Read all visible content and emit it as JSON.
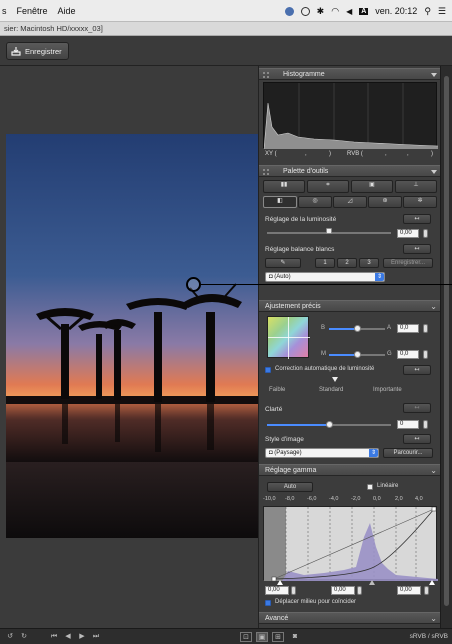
{
  "menubar": {
    "items": [
      "s",
      "Fenêtre",
      "Aide"
    ],
    "clock": "ven. 20:12",
    "flag": "A"
  },
  "window": {
    "title": "sier: Macintosh HD/xxxxx_03]"
  },
  "toolbar": {
    "save_label": "Enregistrer"
  },
  "histogram": {
    "title": "Histogramme",
    "xy_label": "XY (",
    "xy_sep1": ",",
    "xy_close": ")",
    "rvb_label": "RVB (",
    "rvb_sep": ",",
    "rvb_close": ")"
  },
  "tools": {
    "title": "Palette d'outils",
    "brightness_label": "Réglage de la luminosité",
    "brightness_value": "0,00",
    "wb_label": "Réglage balance blancs",
    "wb_btn1": "1",
    "wb_btn2": "2",
    "wb_btn3": "3",
    "wb_register": "Enregistrer...",
    "wb_selected": "(Auto)"
  },
  "fine": {
    "title": "Ajustement précis",
    "b_label": "B",
    "a_label": "A",
    "m_label": "M",
    "g_label": "G",
    "a_value": "0,0",
    "g_value": "0,0",
    "auto_light_label": "Correction automatique de luminosité",
    "weak": "Faible",
    "standard": "Standard",
    "strong": "Importante",
    "clarity_label": "Clarté",
    "clarity_value": "0",
    "style_label": "Style d'image",
    "style_selected": "(Paysage)",
    "browse": "Parcourir..."
  },
  "gamma": {
    "title": "Réglage gamma",
    "auto": "Auto",
    "linear": "Linéaire",
    "ticks": [
      "-10,0",
      "-8,0",
      "-6,0",
      "-4,0",
      "-2,0",
      "0,0",
      "2,0",
      "4,0"
    ],
    "v1": "0,00",
    "v2": "0,00",
    "v3": "0,00",
    "move_mid": "Déplacer milieu pour coïncider"
  },
  "advanced": {
    "title": "Avancé"
  },
  "status": {
    "colorspace": "sRVB / sRVB"
  },
  "colors": {
    "panel_bg": "#3c3c3c",
    "accent": "#3b7ae4"
  }
}
